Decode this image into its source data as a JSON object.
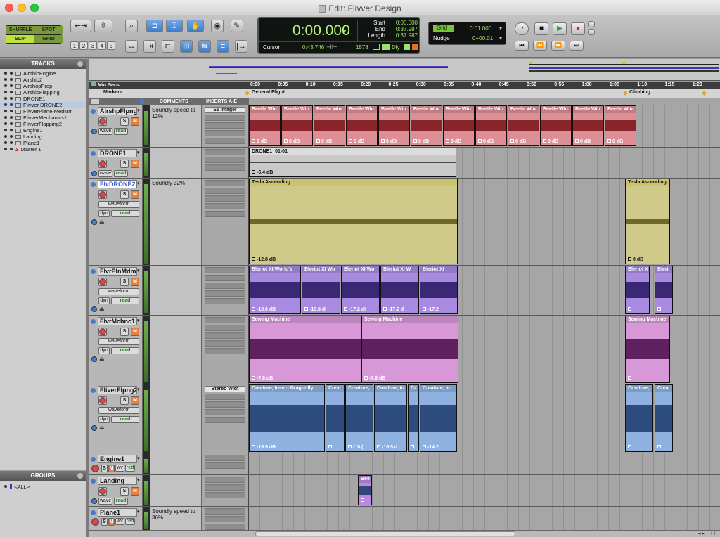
{
  "window": {
    "title": "Edit: Flivver Design"
  },
  "toolbar": {
    "modes": [
      "SHUFFLE",
      "SPOT",
      "SLIP",
      "GRID"
    ],
    "zoom_presets": [
      "1",
      "2",
      "3",
      "4",
      "5"
    ]
  },
  "counter": {
    "main": "0:00.000",
    "start_label": "Start",
    "start": "0:00.000",
    "end_label": "End",
    "end": "0:37.987",
    "length_label": "Length",
    "length": "0:37.987",
    "cursor_label": "Cursor",
    "cursor": "0:43.746",
    "sample_value": "1578",
    "dly_label": "Dly"
  },
  "grid": {
    "label": "Grid",
    "value": "0:01.000",
    "nudge_label": "Nudge",
    "nudge_value": "0+00.01"
  },
  "tracks_panel": {
    "title": "TRACKS",
    "items": [
      "AirshipEngine",
      "Airship2",
      "AirshopProp",
      "AirshipFlapping",
      "DRONE1",
      "Flivver DRONE2",
      "FlivverPlane-Medium",
      "FlivverMechanics1",
      "FlivverFlapping2",
      "Engine1",
      "Landing",
      "Plane1",
      "Master 1"
    ]
  },
  "groups_panel": {
    "title": "GROUPS",
    "items": [
      "<ALL>"
    ]
  },
  "ruler": {
    "timescale": "Min:Secs",
    "markers_label": "Markers",
    "ticks": [
      "0:00",
      "0:05",
      "0:10",
      "0:15",
      "0:20",
      "0:25",
      "0:30",
      "0:35",
      "0:40",
      "0:45",
      "0:50",
      "0:55",
      "1:00",
      "1:05",
      "1:10",
      "1:15",
      "1:20"
    ],
    "markers": [
      "General Flight",
      "Climbing"
    ]
  },
  "columns": {
    "comments": "COMMENTS",
    "inserts": "INSERTS A-E"
  },
  "edit_tracks": [
    {
      "name": "AirshpFlpng",
      "comment": "Soundly speed to 12%",
      "insert": "S1 Imager",
      "view": "wave",
      "auto": "read",
      "clips": [
        {
          "name": "Beetle Win",
          "gain": "0 dB",
          "repeat": 12
        }
      ],
      "color": "#dd8f95"
    },
    {
      "name": "DRONE1",
      "comment": "",
      "insert": "",
      "view": "wave",
      "auto": "read",
      "clips": [
        {
          "name": "DRONE1_01-01",
          "gain": "-6.4 dB"
        }
      ],
      "color": "#c9c9c9"
    },
    {
      "name": "FlvDRONE2",
      "comment": "Soundly 32%",
      "insert": "",
      "view": "waveform",
      "auto": "read",
      "dyn": "dyn",
      "clips": [
        {
          "name": "Tesla Ascending",
          "gain": "-12.8 dB"
        },
        {
          "name": "Tesla Ascending",
          "gain": "0 dB"
        }
      ],
      "color": "#cfc98a"
    },
    {
      "name": "FlvrPlnMdm",
      "comment": "",
      "insert": "",
      "view": "waveform",
      "auto": "read",
      "dyn": "dyn",
      "clips": [
        {
          "name": "Bleriot XI World's",
          "gain": "-18.0 dB"
        },
        {
          "name": "Bleriot XI Wo",
          "gain": "-18.8 dI"
        },
        {
          "name": "Bleriot XI Wo",
          "gain": "-17.2 dI"
        },
        {
          "name": "Bleriot XI W",
          "gain": "-17.2 d"
        },
        {
          "name": "Bleriot XI",
          "gain": "-17.2"
        },
        {
          "name": "Bleriot X",
          "gain": ""
        },
        {
          "name": "Bleri",
          "gain": ""
        }
      ],
      "color": "#a88be0"
    },
    {
      "name": "FlvrMchnc1",
      "comment": "",
      "insert": "",
      "view": "waveform",
      "auto": "read",
      "dyn": "dyn",
      "clips": [
        {
          "name": "Sewing Machine",
          "gain": "-7.8 dB"
        },
        {
          "name": "Sewing Machine",
          "gain": "-7.8 dB"
        },
        {
          "name": "Sewing Machine",
          "gain": ""
        }
      ],
      "color": "#d898d8"
    },
    {
      "name": "FliverFlpng2",
      "comment": "",
      "insert": "Stereo Widt",
      "view": "waveform",
      "auto": "read",
      "dyn": "dyn",
      "clips": [
        {
          "name": "Creature, Insect Dragonfly,",
          "gain": "-16.5 dB"
        },
        {
          "name": "Creat",
          "gain": ""
        },
        {
          "name": "Creature,",
          "gain": "-18.("
        },
        {
          "name": "Creature, In",
          "gain": "-16.5 d"
        },
        {
          "name": "Cr",
          "gain": ""
        },
        {
          "name": "Creature, In",
          "gain": "-14.2"
        },
        {
          "name": "Creature,",
          "gain": ""
        },
        {
          "name": "Crea",
          "gain": ""
        }
      ],
      "color": "#8fb1e0"
    },
    {
      "name": "Engine1",
      "comment": "",
      "insert": "",
      "view": "wv",
      "auto": "red",
      "clips": []
    },
    {
      "name": "Landing",
      "comment": "",
      "insert": "",
      "view": "wave",
      "auto": "read",
      "clips": [
        {
          "name": "Bee",
          "gain": ""
        }
      ],
      "color": "#b889de"
    },
    {
      "name": "Plane1",
      "comment": "Soundly speed to 36%",
      "insert": "",
      "view": "wv",
      "auto": "red",
      "clips": []
    }
  ]
}
